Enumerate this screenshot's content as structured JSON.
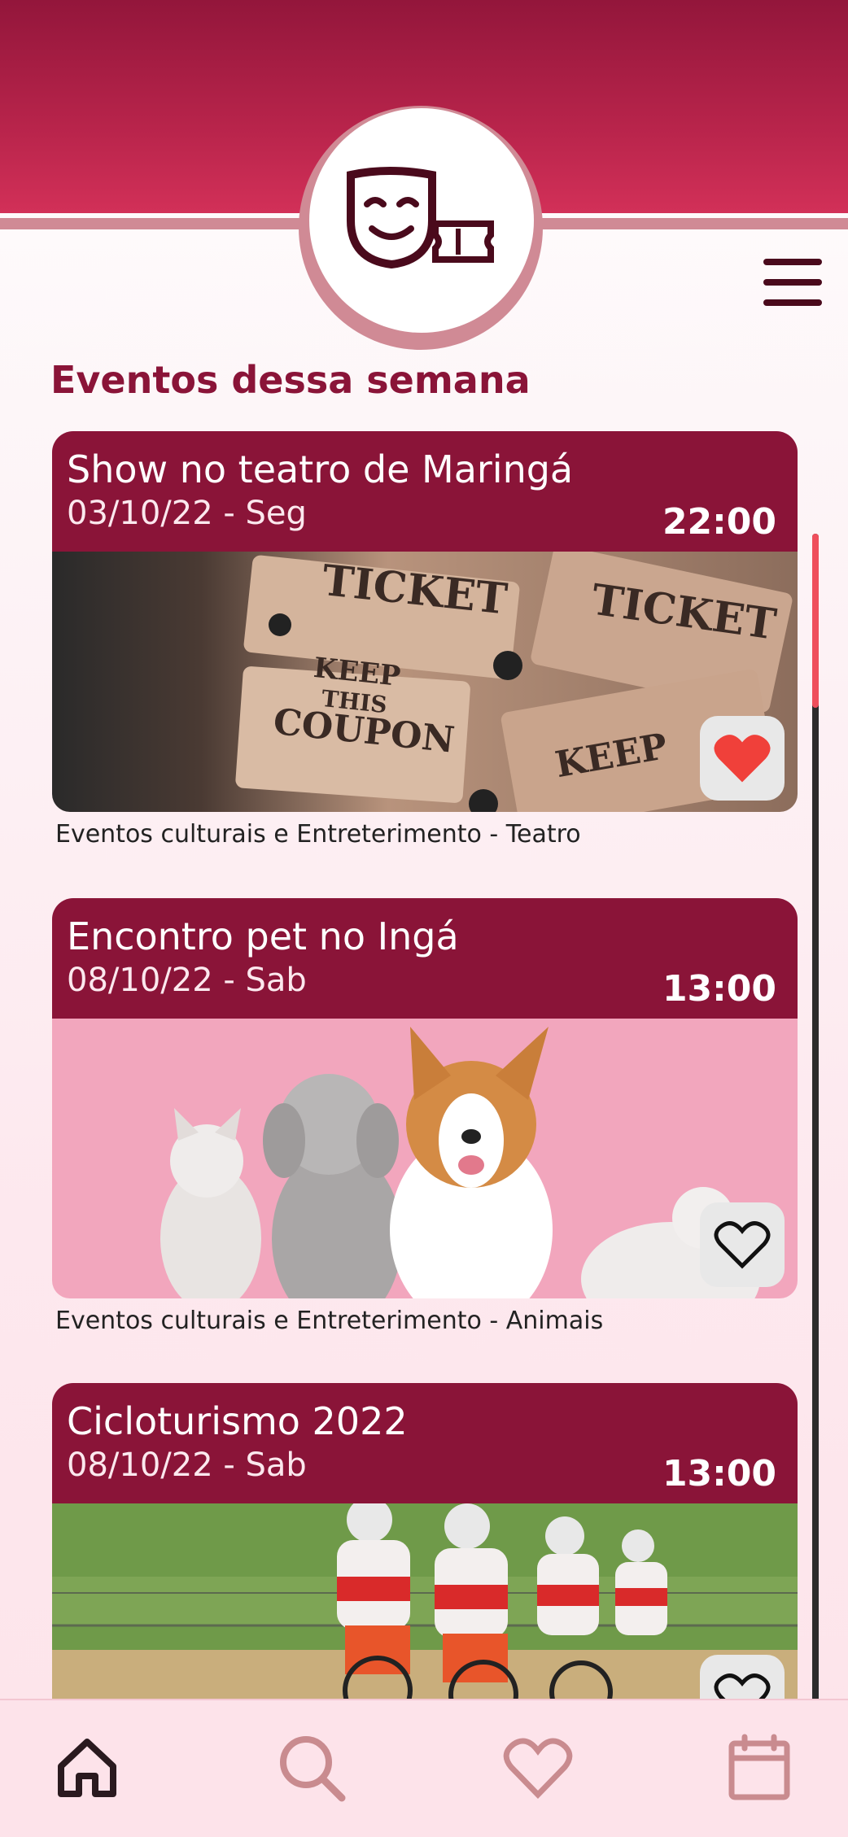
{
  "app": {
    "logo_icon": "theater-mask-ticket-icon",
    "menu_icon": "hamburger-menu-icon"
  },
  "section": {
    "title": "Eventos dessa semana"
  },
  "colors": {
    "brand": "#8a1438",
    "header": "#b8244b",
    "accent": "#d08a95",
    "favorite_active": "#f0403a",
    "scroll_thumb": "#ef4f5c"
  },
  "events": [
    {
      "title": "Show no teatro de Maringá",
      "date": "03/10/22 - Seg",
      "time": "22:00",
      "category": "Eventos culturais e Entreterimento - Teatro",
      "image": "tickets-photo",
      "favorited": true
    },
    {
      "title": "Encontro pet no Ingá",
      "date": "08/10/22 - Sab",
      "time": "13:00",
      "category": "Eventos culturais e Entreterimento - Animais",
      "image": "pets-photo",
      "favorited": false
    },
    {
      "title": "Cicloturismo 2022",
      "date": "08/10/22 - Sab",
      "time": "13:00",
      "category": "",
      "image": "cyclists-photo",
      "favorited": false
    }
  ],
  "nav": [
    {
      "name": "home",
      "icon": "home-icon",
      "active": true
    },
    {
      "name": "search",
      "icon": "search-icon",
      "active": false
    },
    {
      "name": "favorites",
      "icon": "heart-icon",
      "active": false
    },
    {
      "name": "calendar",
      "icon": "calendar-icon",
      "active": false
    }
  ]
}
